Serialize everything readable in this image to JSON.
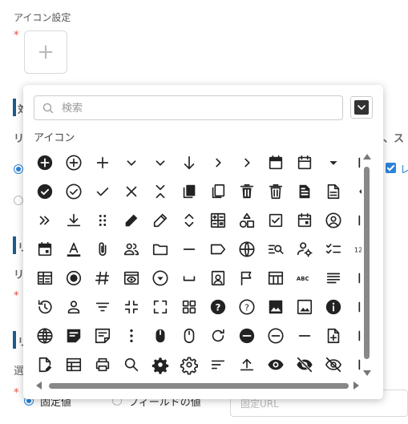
{
  "background": {
    "icon_setting_label": "アイコン設定",
    "required_mark": "*",
    "add_symbol": "+",
    "partial_texts": [
      "対",
      "リ",
      "、ス",
      "レ",
      "リ",
      "リ",
      "リ",
      "選",
      "固定値",
      "フィールドの値",
      "固定URL"
    ]
  },
  "popup": {
    "search_placeholder": "検索",
    "section_label": "アイコン",
    "icon_rows": [
      [
        "plus-circle-filled-icon",
        "plus-circle-icon",
        "plus-icon",
        "chevron-down-icon",
        "chevron-down-icon",
        "arrow-down-icon",
        "chevron-right-icon",
        "chevron-right-icon",
        "calendar-filled-icon",
        "calendar-icon",
        "caret-down-icon",
        "partial-icon"
      ],
      [
        "check-circle-filled-icon",
        "check-circle-icon",
        "check-icon",
        "close-icon",
        "collapse-icon",
        "copy-filled-icon",
        "copy-icon",
        "trash-filled-icon",
        "trash-icon",
        "document-filled-icon",
        "document-icon",
        "chevron-left-icon"
      ],
      [
        "double-chevron-right-icon",
        "download-icon",
        "drag-handle-icon",
        "pencil-filled-icon",
        "pencil-icon",
        "unfold-icon",
        "calculator-icon",
        "shapes-icon",
        "checkbox-icon",
        "event-icon",
        "account-circle-icon",
        "partial-icon"
      ],
      [
        "event-filled-icon",
        "text-color-icon",
        "attach-icon",
        "group-icon",
        "folder-icon",
        "minus-icon",
        "label-icon",
        "globe-icon",
        "search-list-icon",
        "manage-account-icon",
        "checklist-icon",
        "numbers-icon"
      ],
      [
        "table-rows-icon",
        "radio-checked-icon",
        "hash-icon",
        "preview-icon",
        "dropdown-circle-icon",
        "space-bar-icon",
        "badge-icon",
        "flag-icon",
        "table-icon",
        "abc-icon",
        "text-lines-icon",
        "partial-icon"
      ],
      [
        "history-icon",
        "person-icon",
        "filter-icon",
        "fullscreen-exit-icon",
        "fullscreen-icon",
        "grid-view-icon",
        "help-filled-icon",
        "help-icon",
        "image-filled-icon",
        "image-icon",
        "info-filled-icon",
        "partial-icon"
      ],
      [
        "language-icon",
        "note-filled-icon",
        "note-icon",
        "more-vert-icon",
        "mouse-filled-icon",
        "mouse-icon",
        "refresh-icon",
        "remove-circle-filled-icon",
        "remove-circle-icon",
        "remove-icon",
        "note-add-icon",
        "partial-icon"
      ],
      [
        "edit-document-icon",
        "table-view-icon",
        "print-icon",
        "search-icon",
        "settings-filled-icon",
        "settings-icon",
        "sort-icon",
        "upload-icon",
        "visibility-icon",
        "visibility-off-filled-icon",
        "visibility-off-icon",
        "partial-icon"
      ]
    ]
  }
}
